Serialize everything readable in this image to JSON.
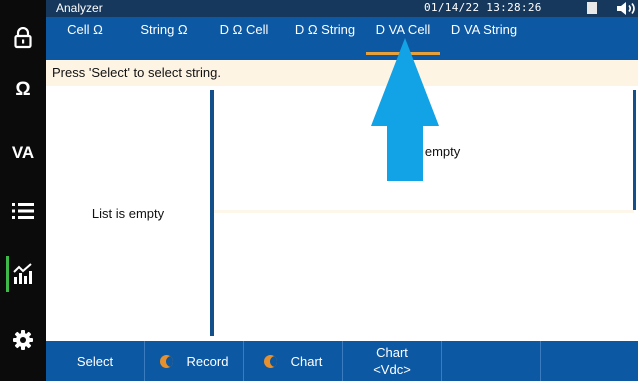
{
  "header": {
    "title": "Analyzer",
    "datetime": "01/14/22 13:28:26"
  },
  "sidebar": {
    "items": [
      {
        "id": "lock",
        "icon": "lock-icon"
      },
      {
        "id": "resistance",
        "label": "Ω",
        "icon": "ohm-icon"
      },
      {
        "id": "voltage-current",
        "label": "VA"
      },
      {
        "id": "list",
        "icon": "list-icon"
      },
      {
        "id": "chart",
        "icon": "chart-icon",
        "active": true
      },
      {
        "id": "settings",
        "icon": "gear-icon"
      }
    ]
  },
  "tabs": [
    {
      "label": "Cell Ω"
    },
    {
      "label": "String Ω"
    },
    {
      "label": "D Ω Cell"
    },
    {
      "label": "D Ω String"
    },
    {
      "label": "D VA Cell",
      "active": true
    },
    {
      "label": "D VA String"
    }
  ],
  "message": "Press 'Select' to select string.",
  "list_panel": {
    "empty_text": "List is empty"
  },
  "chart_panel": {
    "empty_text": "List is empty"
  },
  "function_keys": {
    "f1": "Select",
    "f2": "Record",
    "f3": "Chart",
    "f4_line1": "Chart",
    "f4_line2": "<Vdc>",
    "f5": "",
    "f6": ""
  },
  "colors": {
    "title_bar": "#17385d",
    "tab_bar": "#0c58a3",
    "active_tab_underline": "#e8a13a",
    "message_bg": "#fdf4e4",
    "divider": "#134f8a",
    "toggle": "#e8912c",
    "active_nav": "#3fb84a",
    "pointer_arrow": "#12a2e6"
  }
}
